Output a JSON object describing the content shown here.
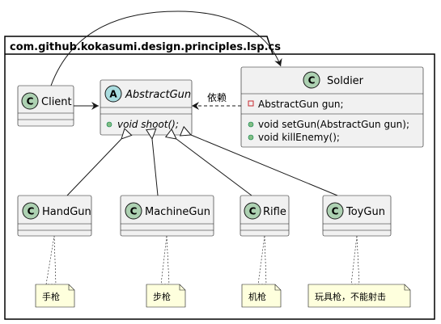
{
  "package": {
    "name": "com.github.kokasumi.design.principles.lsp.cs"
  },
  "classes": {
    "client": {
      "name": "Client",
      "stereo_glyph": "C"
    },
    "abstract_gun": {
      "name": "AbstractGun",
      "stereo_glyph": "A",
      "methods": [
        "void shoot();"
      ]
    },
    "soldier": {
      "name": "Soldier",
      "stereo_glyph": "C",
      "fields": [
        "AbstractGun gun;"
      ],
      "methods": [
        "void setGun(AbstractGun gun);",
        "void killEnemy();"
      ]
    },
    "hand_gun": {
      "name": "HandGun",
      "stereo_glyph": "C"
    },
    "machine_gun": {
      "name": "MachineGun",
      "stereo_glyph": "C"
    },
    "rifle": {
      "name": "Rifle",
      "stereo_glyph": "C"
    },
    "toy_gun": {
      "name": "ToyGun",
      "stereo_glyph": "C"
    }
  },
  "notes": {
    "hand_gun": "手枪",
    "machine_gun": "步枪",
    "rifle": "机枪",
    "toy_gun": "玩具枪，不能射击"
  },
  "relations": {
    "soldier_to_gun_label": "依赖"
  },
  "colors": {
    "class_fill": "#F1F1F1",
    "class_border": "#181818",
    "class_glyph": "#ADD1B2",
    "abstract_glyph": "#A9DCDF",
    "note_fill": "#FEFFDD",
    "field_private": "#C82930",
    "method_public": "#84BE84"
  }
}
